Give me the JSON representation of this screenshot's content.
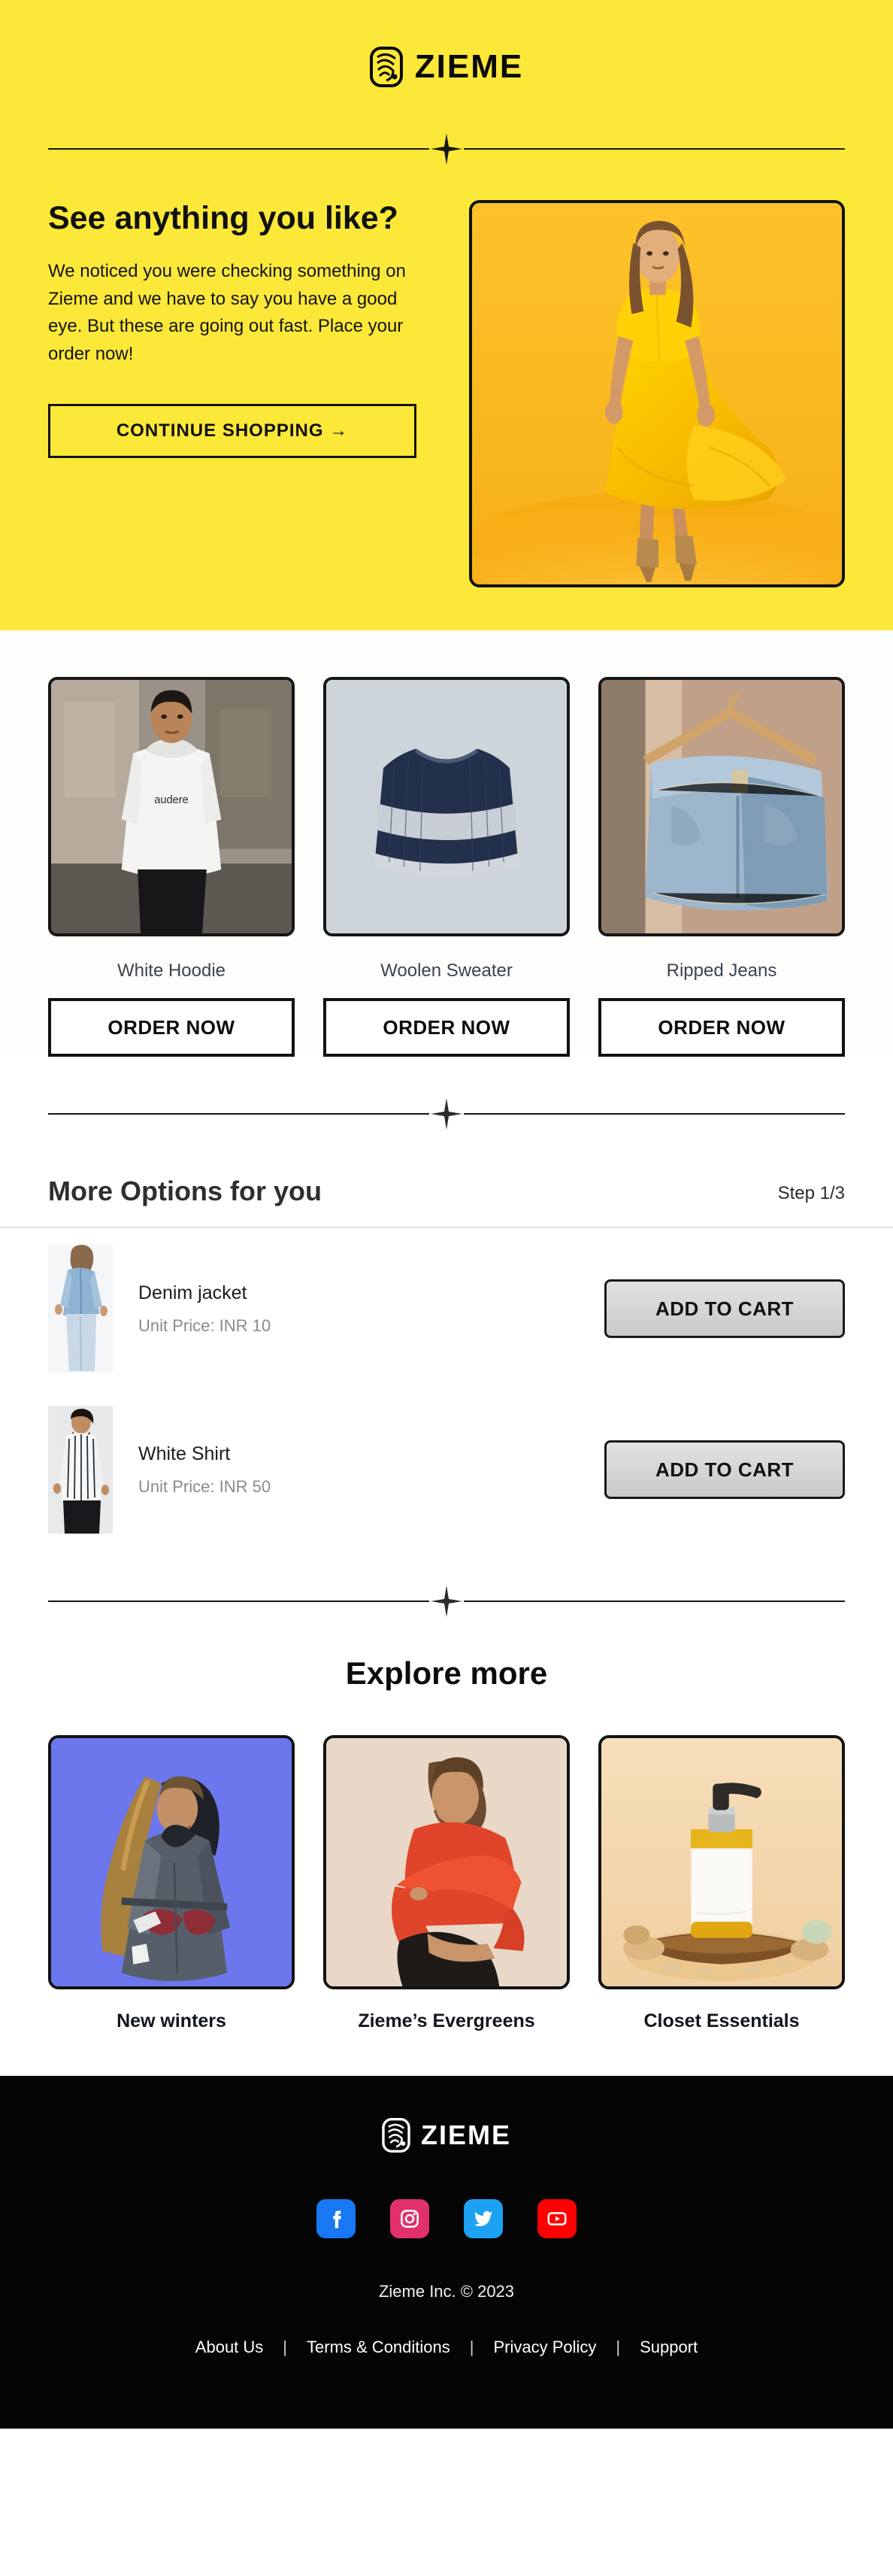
{
  "brand": {
    "name": "ZIEME",
    "logo_icon": "zieme-fingerprint-logo"
  },
  "hero": {
    "heading": "See anything you like?",
    "paragraph": "We noticed you were checking something on Zieme and we have to say you have a good eye. But these are going out fast. Place your order now!",
    "cta_label": "CONTINUE SHOPPING →",
    "image_alt": "woman-in-yellow-dress",
    "background_color": "#FCE838"
  },
  "products": [
    {
      "name": "White Hoodie",
      "cta": "ORDER NOW",
      "image_alt": "man-wearing-white-hoodie"
    },
    {
      "name": "Woolen Sweater",
      "cta": "ORDER NOW",
      "image_alt": "navy-striped-woolen-sweater"
    },
    {
      "name": "Ripped Jeans",
      "cta": "ORDER NOW",
      "image_alt": "light-blue-jeans-on-hanger"
    }
  ],
  "more_options": {
    "title": "More Options for you",
    "step": "Step 1/3",
    "items": [
      {
        "name": "Denim jacket",
        "price": "Unit Price: INR 10",
        "cta": "ADD TO CART",
        "image_alt": "woman-in-denim-jacket"
      },
      {
        "name": "White Shirt",
        "price": "Unit Price: INR 50",
        "cta": "ADD TO CART",
        "image_alt": "man-in-striped-white-shirt"
      }
    ]
  },
  "explore": {
    "title": "Explore more",
    "cards": [
      {
        "label": "New winters",
        "image_alt": "woman-in-winter-coat"
      },
      {
        "label": "Zieme’s Evergreens",
        "image_alt": "woman-in-red-sweater"
      },
      {
        "label": "Closet Essentials",
        "image_alt": "pump-bottle-on-wood-slab"
      }
    ]
  },
  "footer": {
    "brand": "ZIEME",
    "copyright": "Zieme Inc. © 2023",
    "socials": [
      {
        "name": "facebook-icon",
        "color": "#1877F2"
      },
      {
        "name": "instagram-icon",
        "color": "#E1306C"
      },
      {
        "name": "twitter-icon",
        "color": "#1DA1F2"
      },
      {
        "name": "youtube-icon",
        "color": "#FF0000"
      }
    ],
    "links": [
      "About Us",
      "Terms & Conditions",
      "Privacy Policy",
      "Support"
    ],
    "separator": "|",
    "background_color": "#050505"
  }
}
